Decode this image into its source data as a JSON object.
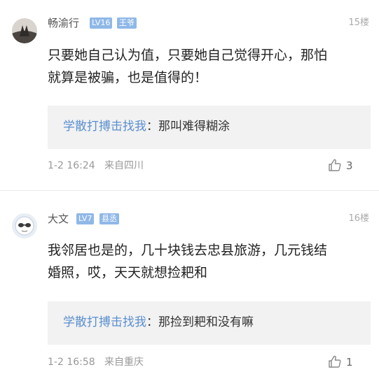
{
  "comments": [
    {
      "username": "畅渝行",
      "level": "LV16",
      "title": "王爷",
      "floor": "15楼",
      "content_lines": [
        "只要她自己认为值，只要她自己觉得开心，那怕",
        "就算是被骗，也是值得的！"
      ],
      "reply": {
        "user": "学散打搏击找我",
        "text": "：那叫难得糊涂"
      },
      "time": "1-2 16:24",
      "location": "来自四川",
      "likes": "3"
    },
    {
      "username": "大文",
      "level": "LV7",
      "title": "县丞",
      "floor": "16楼",
      "content_lines": [
        "我邻居也是的，几十块钱去忠县旅游，几元钱结",
        "婚照，哎，天天就想捡耙和"
      ],
      "reply": {
        "user": "学散打搏击找我",
        "text": "：那捡到耙和没有嘛"
      },
      "time": "1-2 16:58",
      "location": "来自重庆",
      "likes": "1"
    }
  ],
  "colors": {
    "level_badge": "#8fb8e8",
    "title_badge": "#8fb8e8",
    "reply_user": "#5a8fd0",
    "reply_bg": "#f2f2f2"
  },
  "icons": {
    "like": "thumb-up-icon"
  }
}
